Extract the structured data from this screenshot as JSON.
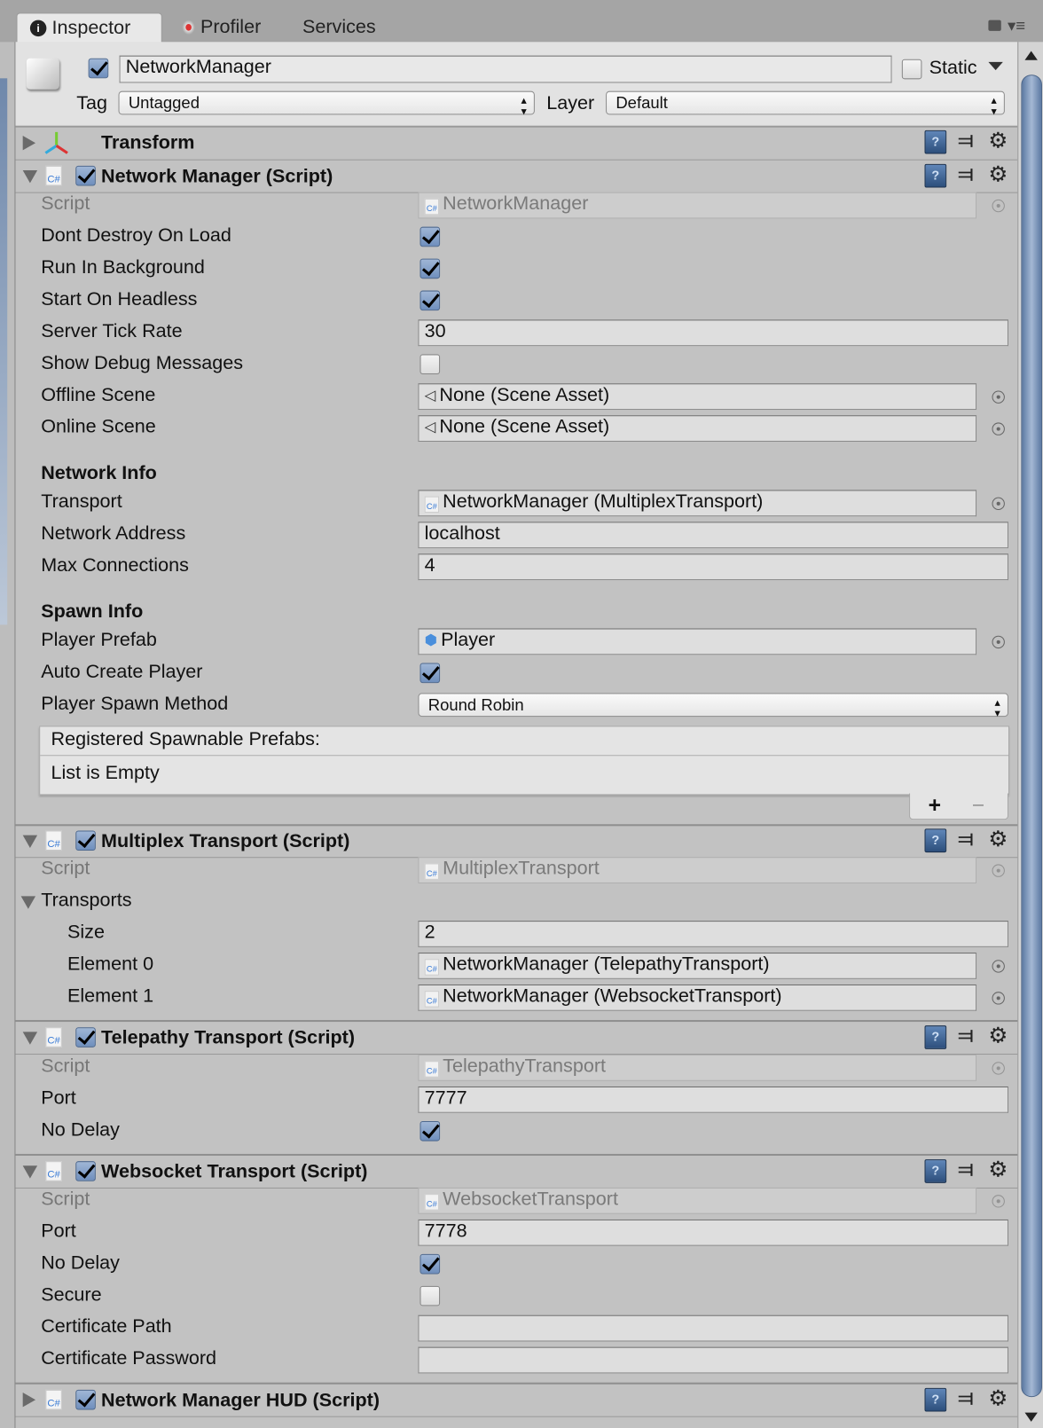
{
  "tabs": [
    {
      "label": "Inspector",
      "icon": "info-icon",
      "active": true
    },
    {
      "label": "Profiler",
      "icon": "profiler-icon",
      "active": false
    },
    {
      "label": "Services",
      "icon": "",
      "active": false
    }
  ],
  "gameobject": {
    "active": true,
    "name": "NetworkManager",
    "static_label": "Static",
    "static": false,
    "tag_label": "Tag",
    "tag": "Untagged",
    "layer_label": "Layer",
    "layer": "Default"
  },
  "transform": {
    "title": "Transform",
    "expanded": false
  },
  "components": [
    {
      "title": "Network Manager (Script)",
      "enabled": true,
      "expanded": true,
      "rows": [
        {
          "type": "object",
          "label": "Script",
          "value": "NetworkManager",
          "icon": "cs",
          "disabled": true
        },
        {
          "type": "checkbox",
          "label": "Dont Destroy On Load",
          "value": true
        },
        {
          "type": "checkbox",
          "label": "Run In Background",
          "value": true
        },
        {
          "type": "checkbox",
          "label": "Start On Headless",
          "value": true
        },
        {
          "type": "text",
          "label": "Server Tick Rate",
          "value": "30"
        },
        {
          "type": "checkbox",
          "label": "Show Debug Messages",
          "value": false
        },
        {
          "type": "object",
          "label": "Offline Scene",
          "value": "None (Scene Asset)",
          "icon": "unity"
        },
        {
          "type": "object",
          "label": "Online Scene",
          "value": "None (Scene Asset)",
          "icon": "unity"
        },
        {
          "type": "heading",
          "label": "Network Info"
        },
        {
          "type": "object",
          "label": "Transport",
          "value": "NetworkManager (MultiplexTransport)",
          "icon": "cs"
        },
        {
          "type": "text",
          "label": "Network Address",
          "value": "localhost"
        },
        {
          "type": "text",
          "label": "Max Connections",
          "value": "4"
        },
        {
          "type": "heading",
          "label": "Spawn Info"
        },
        {
          "type": "object",
          "label": "Player Prefab",
          "value": "Player",
          "icon": "prefab"
        },
        {
          "type": "checkbox",
          "label": "Auto Create Player",
          "value": true
        },
        {
          "type": "dropdown",
          "label": "Player Spawn Method",
          "value": "Round Robin"
        }
      ],
      "list": {
        "header": "Registered Spawnable Prefabs:",
        "empty_text": "List is Empty",
        "add": "+",
        "remove": "−"
      }
    },
    {
      "title": "Multiplex Transport (Script)",
      "enabled": true,
      "expanded": true,
      "rows": [
        {
          "type": "object",
          "label": "Script",
          "value": "MultiplexTransport",
          "icon": "cs",
          "disabled": true
        },
        {
          "type": "foldout",
          "label": "Transports"
        },
        {
          "type": "text",
          "label": "Size",
          "value": "2",
          "indent": true
        },
        {
          "type": "object",
          "label": "Element 0",
          "value": "NetworkManager (TelepathyTransport)",
          "icon": "cs",
          "indent": true
        },
        {
          "type": "object",
          "label": "Element 1",
          "value": "NetworkManager (WebsocketTransport)",
          "icon": "cs",
          "indent": true
        }
      ]
    },
    {
      "title": "Telepathy Transport (Script)",
      "enabled": true,
      "expanded": true,
      "rows": [
        {
          "type": "object",
          "label": "Script",
          "value": "TelepathyTransport",
          "icon": "cs",
          "disabled": true
        },
        {
          "type": "text",
          "label": "Port",
          "value": "7777"
        },
        {
          "type": "checkbox",
          "label": "No Delay",
          "value": true
        }
      ]
    },
    {
      "title": "Websocket Transport (Script)",
      "enabled": true,
      "expanded": true,
      "rows": [
        {
          "type": "object",
          "label": "Script",
          "value": "WebsocketTransport",
          "icon": "cs",
          "disabled": true
        },
        {
          "type": "text",
          "label": "Port",
          "value": "7778"
        },
        {
          "type": "checkbox",
          "label": "No Delay",
          "value": true
        },
        {
          "type": "checkbox",
          "label": "Secure",
          "value": false
        },
        {
          "type": "text",
          "label": "Certificate Path",
          "value": ""
        },
        {
          "type": "text",
          "label": "Certificate Password",
          "value": ""
        }
      ]
    },
    {
      "title": "Network Manager HUD (Script)",
      "enabled": true,
      "expanded": false,
      "rows": []
    }
  ]
}
